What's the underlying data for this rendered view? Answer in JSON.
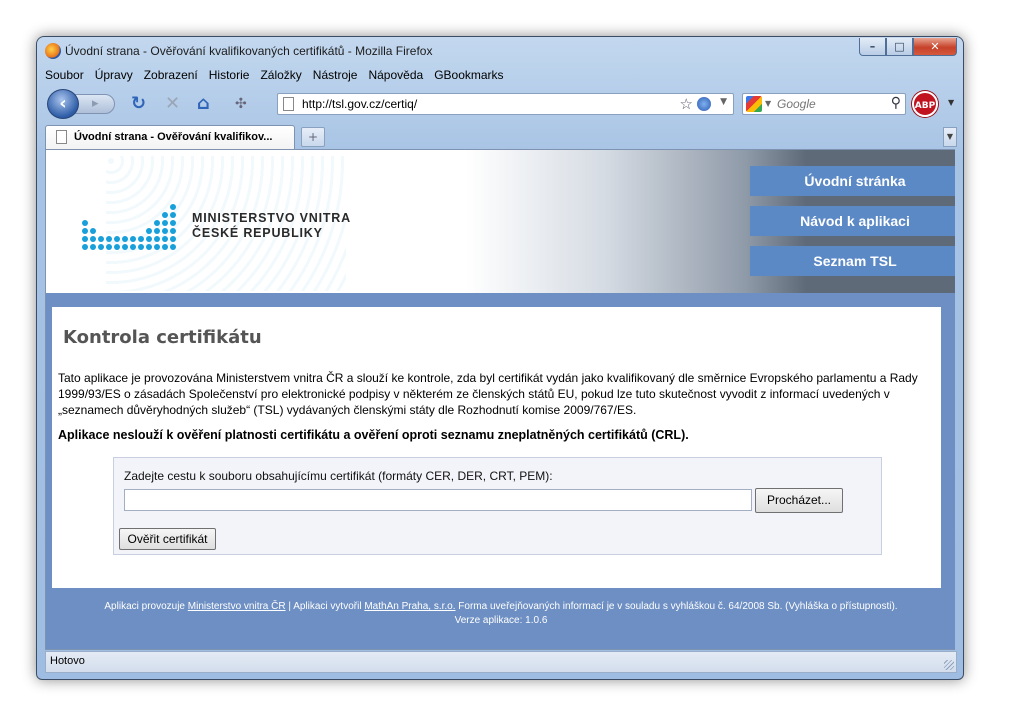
{
  "window": {
    "title": "Úvodní strana - Ověřování kvalifikovaných certifikátů - Mozilla Firefox"
  },
  "menu": [
    "Soubor",
    "Úpravy",
    "Zobrazení",
    "Historie",
    "Záložky",
    "Nástroje",
    "Nápověda",
    "GBookmarks"
  ],
  "toolbar": {
    "url": "http://tsl.gov.cz/certiq/",
    "search_placeholder": "Google",
    "adblock_label": "ABP",
    "back_icon": "back-arrow-icon",
    "reload_icon": "reload-icon",
    "stop_icon": "stop-icon",
    "home_icon": "home-icon"
  },
  "tab": {
    "label": "Úvodní strana - Ověřování kvalifikov..."
  },
  "site": {
    "logo_line1": "MINISTERSTVO VNITRA",
    "logo_line2": "ČESKÉ REPUBLIKY",
    "nav": [
      "Úvodní stránka",
      "Návod k aplikaci",
      "Seznam TSL"
    ],
    "accent_color": "#5b89c6"
  },
  "main": {
    "title": "Kontrola certifikátu",
    "intro": "Tato aplikace je provozována Ministerstvem vnitra ČR a slouží ke kontrole, zda byl certifikát vydán jako kvalifikovaný dle směrnice Evropského parlamentu a Rady 1999/93/ES o zásadách Společenství pro elektronické podpisy v některém ze členských států EU, pokud lze tuto skutečnost vyvodit z informací uvedených v „seznamech důvěryhodných služeb“ (TSL) vydávaných členskými státy dle Rozhodnutí komise 2009/767/ES.",
    "warning": "Aplikace neslouží k ověření platnosti certifikátu a ověření oproti seznamu zneplatněných certifikátů (CRL).",
    "form_label": "Zadejte cestu k souboru obsahujícímu certifikát (formáty CER, DER, CRT, PEM):",
    "file_value": "",
    "browse_label": "Procházet...",
    "verify_label": "Ověřit certifikát"
  },
  "footer": {
    "prefix": "Aplikaci provozuje",
    "operator_link": "Ministerstvo vnitra ČR",
    "separator": "| Aplikaci vytvořil",
    "author_link": "MathAn Praha, s.r.o.",
    "suffix": "Forma uveřejňovaných informací je v souladu s vyhláškou č. 64/2008 Sb. (Vyhláška o přístupnosti).",
    "version": "Verze aplikace: 1.0.6"
  },
  "status": {
    "text": "Hotovo"
  }
}
